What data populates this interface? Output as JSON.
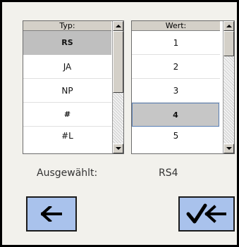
{
  "typ_list": {
    "header": "Typ:",
    "items": [
      "RS",
      "JA",
      "NP",
      "#",
      "#L"
    ]
  },
  "wert_list": {
    "header": "Wert:",
    "items": [
      "1",
      "2",
      "3",
      "4",
      "5"
    ]
  },
  "selection": {
    "label": "Ausgewählt:",
    "value": "RS4"
  },
  "icons": {
    "back": "arrow-left-icon",
    "confirm": "check-arrow-left-icon",
    "scroll_up": "scroll-up-arrow-icon",
    "scroll_down": "scroll-down-arrow-icon"
  },
  "colors": {
    "button_bg": "#a9c2ec",
    "selected_row": "#bfbfbf",
    "focus_border": "#5a7fb5"
  }
}
